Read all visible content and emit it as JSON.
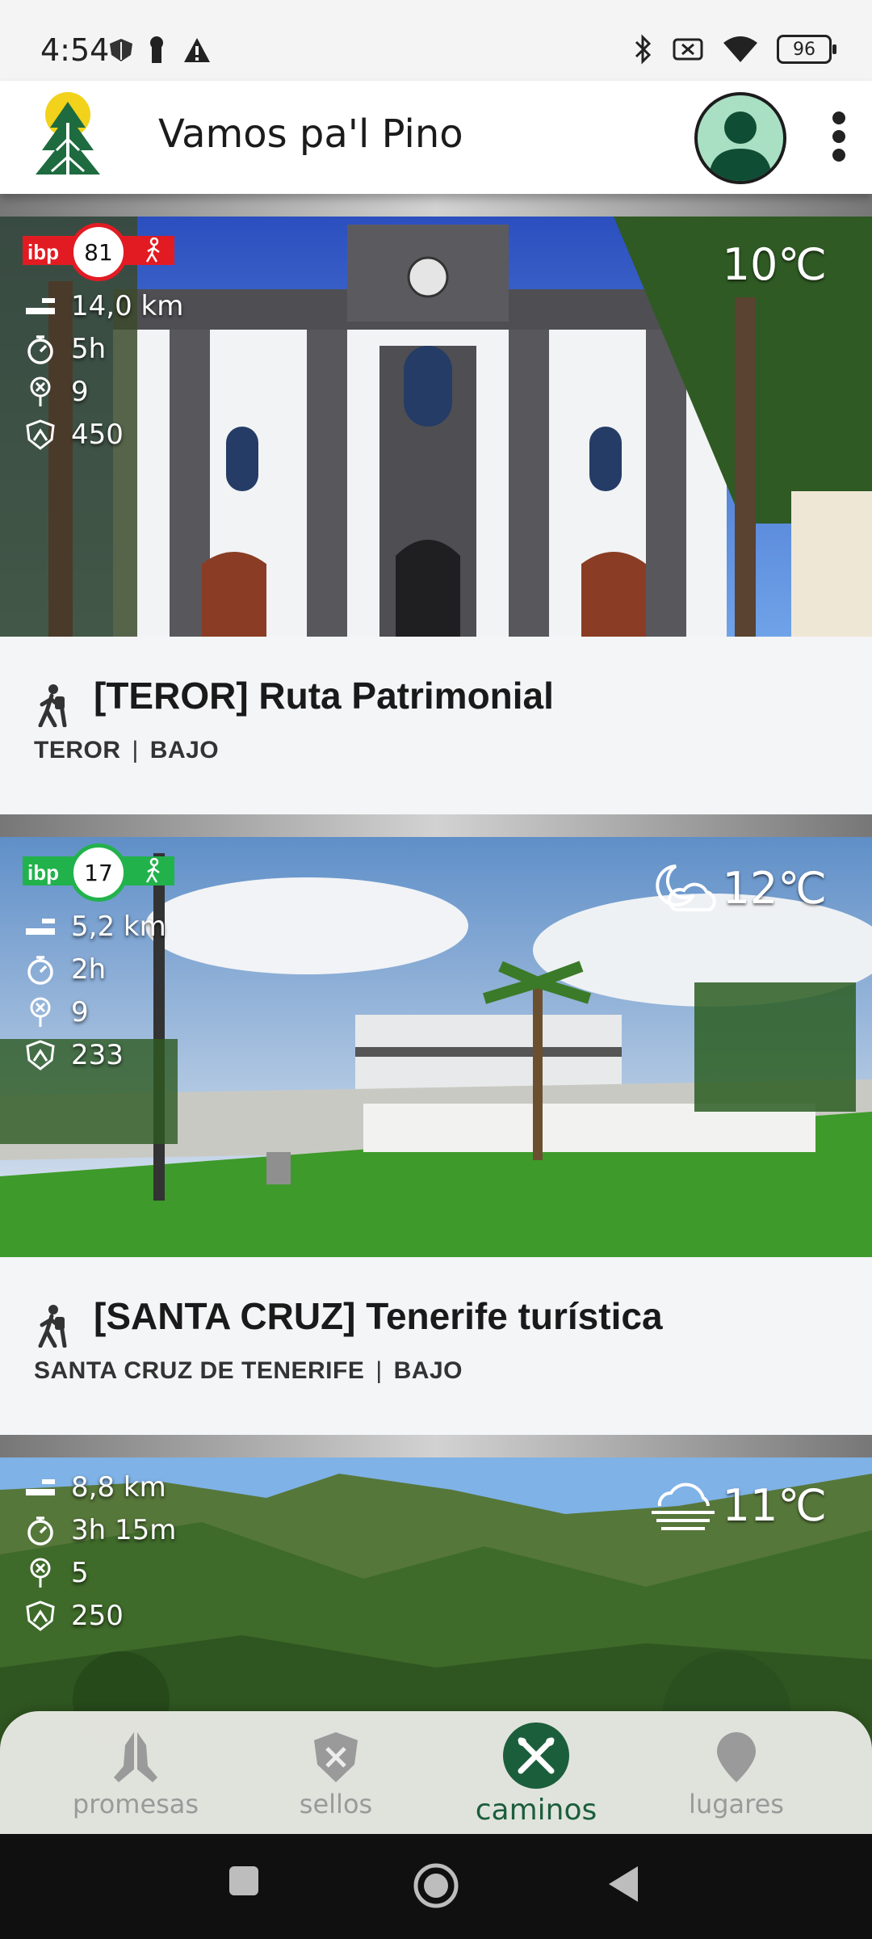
{
  "status_bar": {
    "time": "4:54",
    "battery": "96"
  },
  "app_bar": {
    "title": "Vamos pa'l Pino"
  },
  "routes": [
    {
      "ibp_label": "ibp",
      "ibp_value": "81",
      "ibp_color": "#e21b23",
      "distance": "14,0 km",
      "duration": "5h",
      "points": "9",
      "elevation": "450",
      "temperature": "10℃",
      "weather": "none",
      "title": "[TEROR] Ruta Patrimonial",
      "location": "TEROR",
      "difficulty": "BAJO"
    },
    {
      "ibp_label": "ibp",
      "ibp_value": "17",
      "ibp_color": "#22b24c",
      "distance": "5,2 km",
      "duration": "2h",
      "points": "9",
      "elevation": "233",
      "temperature": "12℃",
      "weather": "moon-cloud",
      "title": "[SANTA CRUZ] Tenerife turística",
      "location": "SANTA CRUZ DE TENERIFE",
      "difficulty": "BAJO"
    },
    {
      "distance": "8,8 km",
      "duration": "3h 15m",
      "points": "5",
      "elevation": "250",
      "temperature": "11℃",
      "weather": "fog"
    }
  ],
  "bottom_nav": [
    {
      "label": "promesas",
      "icon": "praying-hands-icon"
    },
    {
      "label": "sellos",
      "icon": "seal-shield-icon"
    },
    {
      "label": "caminos",
      "icon": "crossed-sticks-icon",
      "active": true
    },
    {
      "label": "lugares",
      "icon": "location-pin-icon"
    }
  ],
  "colors": {
    "accent": "#1b5e3c",
    "avatar": "#a9e0c4"
  }
}
